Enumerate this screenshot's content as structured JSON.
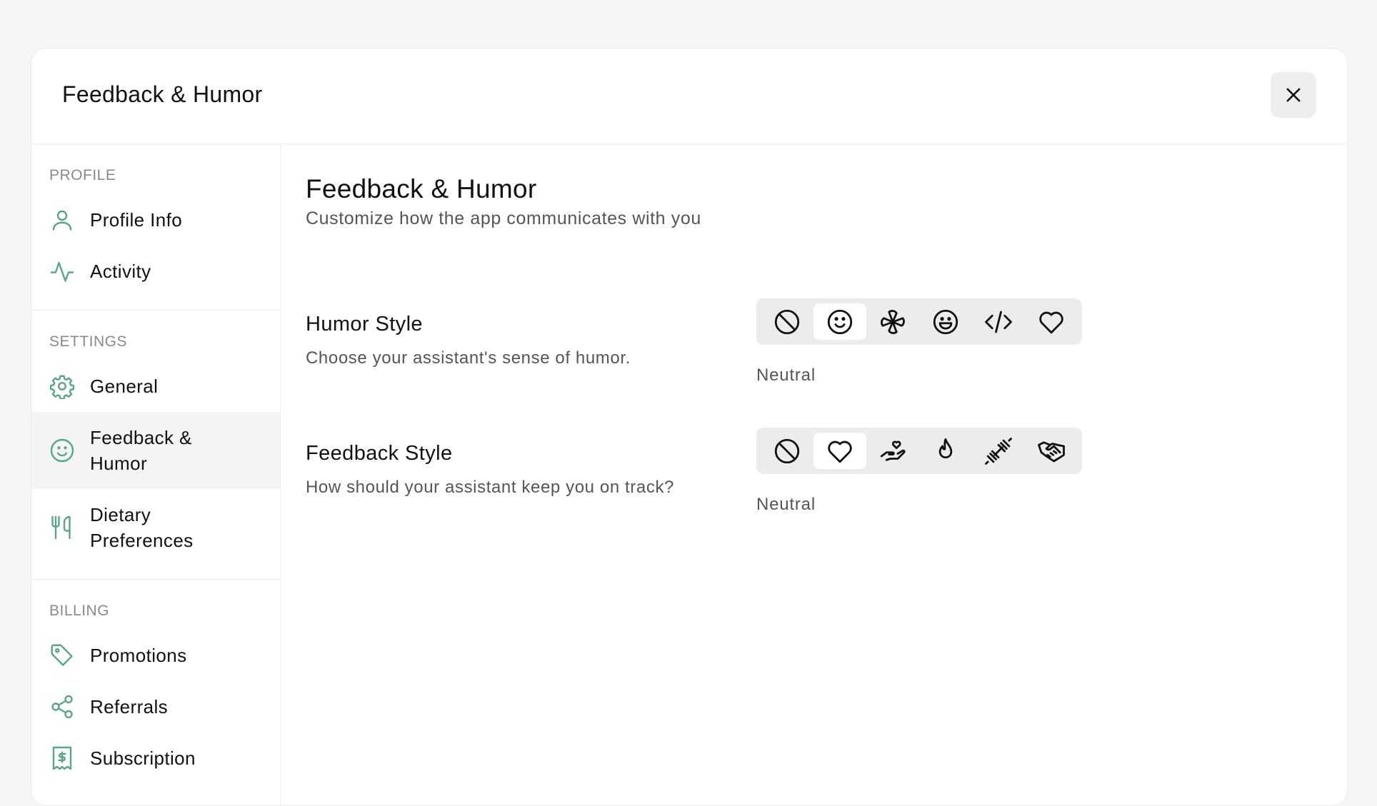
{
  "modal": {
    "title": "Feedback & Humor"
  },
  "sidebar": {
    "sections": [
      {
        "label": "PROFILE",
        "items": [
          {
            "label": "Profile Info",
            "icon": "user-icon"
          },
          {
            "label": "Activity",
            "icon": "activity-icon"
          }
        ]
      },
      {
        "label": "SETTINGS",
        "items": [
          {
            "label": "General",
            "icon": "gear-icon"
          },
          {
            "label": "Feedback & Humor",
            "icon": "smile-icon",
            "active": true
          },
          {
            "label": "Dietary Preferences",
            "icon": "utensils-icon"
          }
        ]
      },
      {
        "label": "BILLING",
        "items": [
          {
            "label": "Promotions",
            "icon": "tag-icon"
          },
          {
            "label": "Referrals",
            "icon": "share-icon"
          },
          {
            "label": "Subscription",
            "icon": "receipt-icon"
          }
        ]
      }
    ]
  },
  "main": {
    "title": "Feedback & Humor",
    "subtitle": "Customize how the app communicates with you",
    "humor": {
      "title": "Humor Style",
      "description": "Choose your assistant's sense of humor.",
      "selected_caption": "Neutral",
      "options": [
        "ban-icon",
        "smile-icon",
        "pinwheel-icon",
        "grin-icon",
        "code-icon",
        "heart-icon"
      ],
      "selected_index": 1
    },
    "feedback": {
      "title": "Feedback Style",
      "description": "How should your assistant keep you on track?",
      "selected_caption": "Neutral",
      "options": [
        "ban-icon",
        "heart-icon",
        "hand-heart-icon",
        "flame-icon",
        "dumbbell-icon",
        "handshake-icon"
      ],
      "selected_index": 1
    }
  },
  "colors": {
    "accent": "#5aa58a",
    "active_bg": "#f4f4f4",
    "segment_bg": "#ececec"
  }
}
